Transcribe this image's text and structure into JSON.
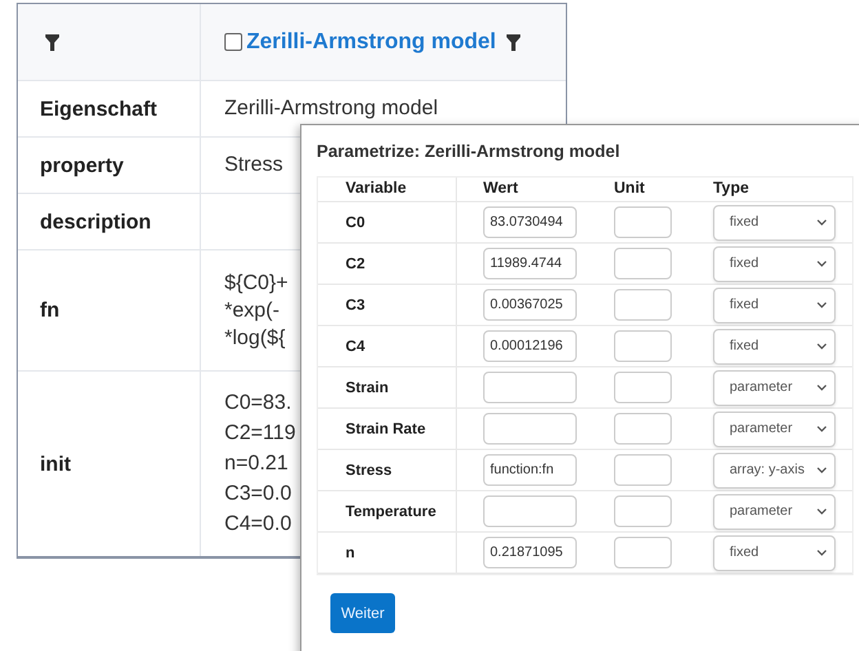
{
  "main_table": {
    "header": {
      "checkbox": {
        "checked": false
      },
      "title": "Zerilli-Armstrong model"
    },
    "rows": [
      {
        "label": "Eigenschaft",
        "lines": [
          "Zerilli-Armstrong model"
        ]
      },
      {
        "label": "property",
        "lines": [
          "Stress"
        ]
      },
      {
        "label": "description"
      },
      {
        "label": "fn",
        "lines": [
          "${C0}+",
          "*exp(-",
          "*log(${"
        ]
      },
      {
        "label": "init",
        "lines": [
          "C0=83.",
          "C2=119",
          "n=0.21",
          "C3=0.0",
          "C4=0.0"
        ]
      }
    ]
  },
  "dialog": {
    "title": "Parametrize: Zerilli-Armstrong model",
    "columns": [
      "Variable",
      "Wert",
      "Unit",
      "Type"
    ],
    "rows": [
      {
        "variable": "C0",
        "value": "83.0730494",
        "type": "fixed"
      },
      {
        "variable": "C2",
        "value": "11989.4744",
        "type": "fixed"
      },
      {
        "variable": "C3",
        "value": "0.00367025",
        "type": "fixed"
      },
      {
        "variable": "C4",
        "value": "0.00012196",
        "type": "fixed"
      },
      {
        "variable": "Strain",
        "type": "parameter"
      },
      {
        "variable": "Strain Rate",
        "type": "parameter"
      },
      {
        "variable": "Stress",
        "value": "function:fn",
        "type": "array: y-axis"
      },
      {
        "variable": "Temperature",
        "type": "parameter"
      },
      {
        "variable": "n",
        "value": "0.21871095",
        "type": "fixed"
      }
    ],
    "button": "Weiter"
  }
}
